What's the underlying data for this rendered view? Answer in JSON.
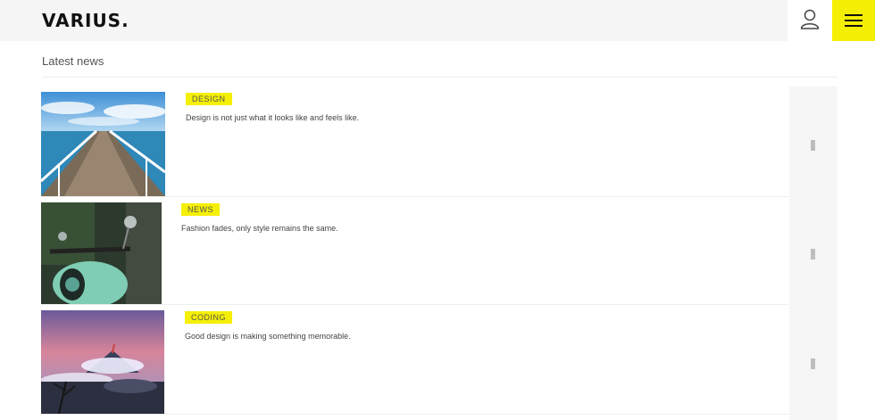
{
  "brand": {
    "logo": "VARIUS."
  },
  "header": {
    "user_icon": "user-icon",
    "menu_icon": "hamburger-menu-icon",
    "accent": "#f5ef05"
  },
  "section": {
    "title": "Latest news"
  },
  "news": [
    {
      "tag": "DESIGN",
      "text": "Design is not just what it looks like and feels like.",
      "image": "pier-over-sea"
    },
    {
      "tag": "NEWS",
      "text": "Fashion fades, only style remains the same.",
      "image": "mint-scooter"
    },
    {
      "tag": "CODING",
      "text": "Good design is making something memorable.",
      "image": "volcano-landscape"
    }
  ]
}
